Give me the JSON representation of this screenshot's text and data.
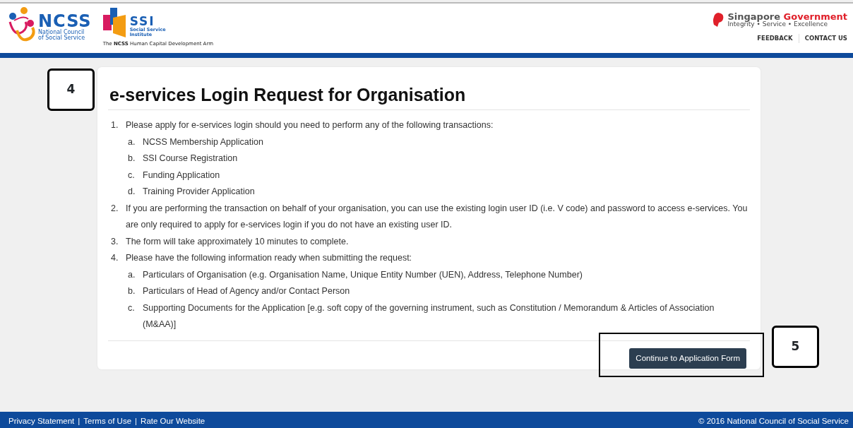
{
  "header": {
    "ncss_logo": {
      "acronym": "NCSS",
      "name_lines": [
        "National Council",
        "of Social Service"
      ]
    },
    "ssi_logo": {
      "acronym": "SSI",
      "name_lines": [
        "Social Service",
        "Institute"
      ],
      "tagline": "The **NCSS** Human Capital Development Arm"
    },
    "gov_logo": {
      "name_first": "Singapore",
      "name_second": "Government",
      "motto": "Integrity • Service • Excellence"
    },
    "links": [
      "FEEDBACK",
      "CONTACT US"
    ]
  },
  "card": {
    "title": "e-services Login Request for Organisation",
    "items": [
      {
        "marker": "1.",
        "text": "Please apply for e-services login should you need to perform any of the following transactions:",
        "children": [
          {
            "marker": "a.",
            "text": "NCSS Membership Application"
          },
          {
            "marker": "b.",
            "text": "SSI Course Registration"
          },
          {
            "marker": "c.",
            "text": "Funding Application"
          },
          {
            "marker": "d.",
            "text": "Training Provider Application"
          }
        ]
      },
      {
        "marker": "2.",
        "text": "If you are performing the transaction on behalf of your organisation, you can use the existing login user ID (i.e. V code) and password to access e-services. You are only required to apply for e-services login if you do not have an existing user ID."
      },
      {
        "marker": "3.",
        "text": "The form will take approximately 10 minutes to complete."
      },
      {
        "marker": "4.",
        "text": "Please have the following information ready when submitting the request:",
        "children": [
          {
            "marker": "a.",
            "text": "Particulars of Organisation (e.g. Organisation Name, Unique Entity Number (UEN), Address, Telephone Number)"
          },
          {
            "marker": "b.",
            "text": "Particulars of Head of Agency and/or Contact Person"
          },
          {
            "marker": "c.",
            "text": "Supporting Documents for the Application [e.g. soft copy of the governing instrument, such as Constitution / Memorandum & Articles of Association (M&AA)]"
          }
        ]
      }
    ],
    "button": "Continue to Application Form"
  },
  "annotations": [
    "4",
    "5"
  ],
  "footer": {
    "items": [
      {
        "kind": "link",
        "text": "Privacy Statement"
      },
      {
        "kind": "separator",
        "text": "|"
      },
      {
        "kind": "link",
        "text": "Terms of Use"
      },
      {
        "kind": "separator",
        "text": "|"
      },
      {
        "kind": "link",
        "text": "Rate Our Website"
      }
    ],
    "copyright": "© 2016 National Council of Social Service"
  }
}
